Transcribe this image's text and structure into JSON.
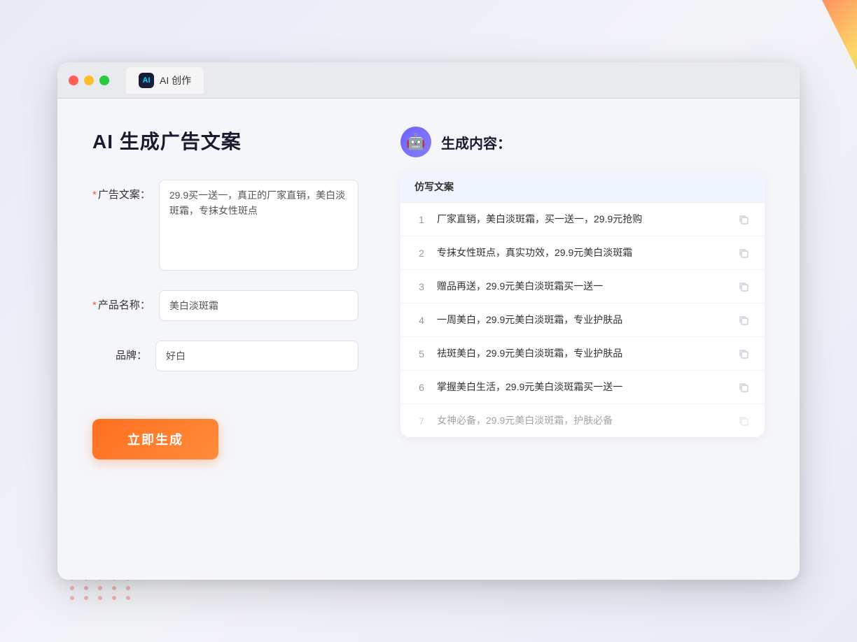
{
  "window": {
    "tab_label": "AI 创作",
    "traffic_lights": [
      "red",
      "yellow",
      "green"
    ]
  },
  "left_panel": {
    "page_title": "AI 生成广告文案",
    "form": {
      "ad_copy_label": "广告文案：",
      "ad_copy_required": "*",
      "ad_copy_value": "29.9买一送一，真正的厂家直销，美白淡斑霜，专抹女性斑点",
      "product_name_label": "产品名称：",
      "product_name_required": "*",
      "product_name_value": "美白淡斑霜",
      "brand_label": "品牌：",
      "brand_value": "好白"
    },
    "generate_btn_label": "立即生成"
  },
  "right_panel": {
    "result_title": "生成内容：",
    "table_header": "仿写文案",
    "rows": [
      {
        "num": "1",
        "text": "厂家直销，美白淡斑霜，买一送一，29.9元抢购",
        "faded": false
      },
      {
        "num": "2",
        "text": "专抹女性斑点，真实功效，29.9元美白淡斑霜",
        "faded": false
      },
      {
        "num": "3",
        "text": "赠品再送，29.9元美白淡斑霜买一送一",
        "faded": false
      },
      {
        "num": "4",
        "text": "一周美白，29.9元美白淡斑霜，专业护肤品",
        "faded": false
      },
      {
        "num": "5",
        "text": "祛斑美白，29.9元美白淡斑霜，专业护肤品",
        "faded": false
      },
      {
        "num": "6",
        "text": "掌握美白生活，29.9元美白淡斑霜买一送一",
        "faded": false
      },
      {
        "num": "7",
        "text": "女神必备，29.9元美白淡斑霜，护肤必备",
        "faded": true
      }
    ]
  },
  "colors": {
    "orange": "#ff7020",
    "purple": "#6c63ff",
    "red_dot": "#ff5252"
  }
}
